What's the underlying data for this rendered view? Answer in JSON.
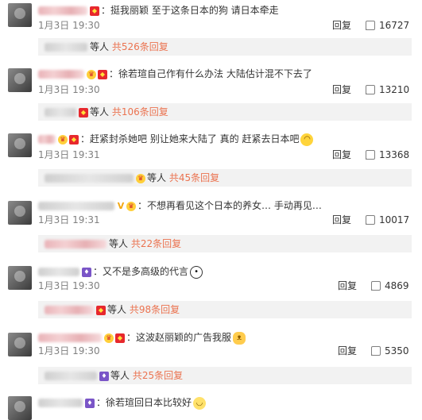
{
  "comments": [
    {
      "text": "：挺我丽颖 至于这条日本的狗 请日本牵走",
      "date": "1月3日 19:30",
      "reply": "回复",
      "likes": "16727",
      "sub_pre": "等人",
      "sub_link": "共526条回复"
    },
    {
      "text": "：徐若瑄自己作有什么办法 大陆估计混不下去了",
      "date": "1月3日 19:30",
      "reply": "回复",
      "likes": "13210",
      "sub_pre": "等人",
      "sub_link": "共106条回复"
    },
    {
      "text": "：赶紧封杀她吧 别让她来大陆了 真的 赶紧去日本吧",
      "date": "1月3日 19:31",
      "reply": "回复",
      "likes": "13368",
      "sub_pre": "等人",
      "sub_link": "共45条回复"
    },
    {
      "text": "：不想再看见这个日本的养女… 手动再见…",
      "date": "1月3日 19:31",
      "reply": "回复",
      "likes": "10017",
      "sub_pre": "等人",
      "sub_link": "共22条回复"
    },
    {
      "text": "：又不是多高级的代言",
      "date": "1月3日 19:30",
      "reply": "回复",
      "likes": "4869",
      "sub_pre": "等人",
      "sub_link": "共98条回复"
    },
    {
      "text": "：这波赵丽颖的广告我服",
      "date": "1月3日 19:30",
      "reply": "回复",
      "likes": "5350",
      "sub_pre": "等人",
      "sub_link": "共25条回复"
    },
    {
      "text": "：徐若瑄回日本比较好"
    }
  ],
  "colors": {
    "link": "#eb7350",
    "meta": "#808080",
    "subbox_bg": "#f2f2f2"
  },
  "icons": [
    "thumbs-up-icon",
    "red-badge-icon",
    "crown-badge-icon",
    "purple-member-icon",
    "verified-v-icon"
  ]
}
